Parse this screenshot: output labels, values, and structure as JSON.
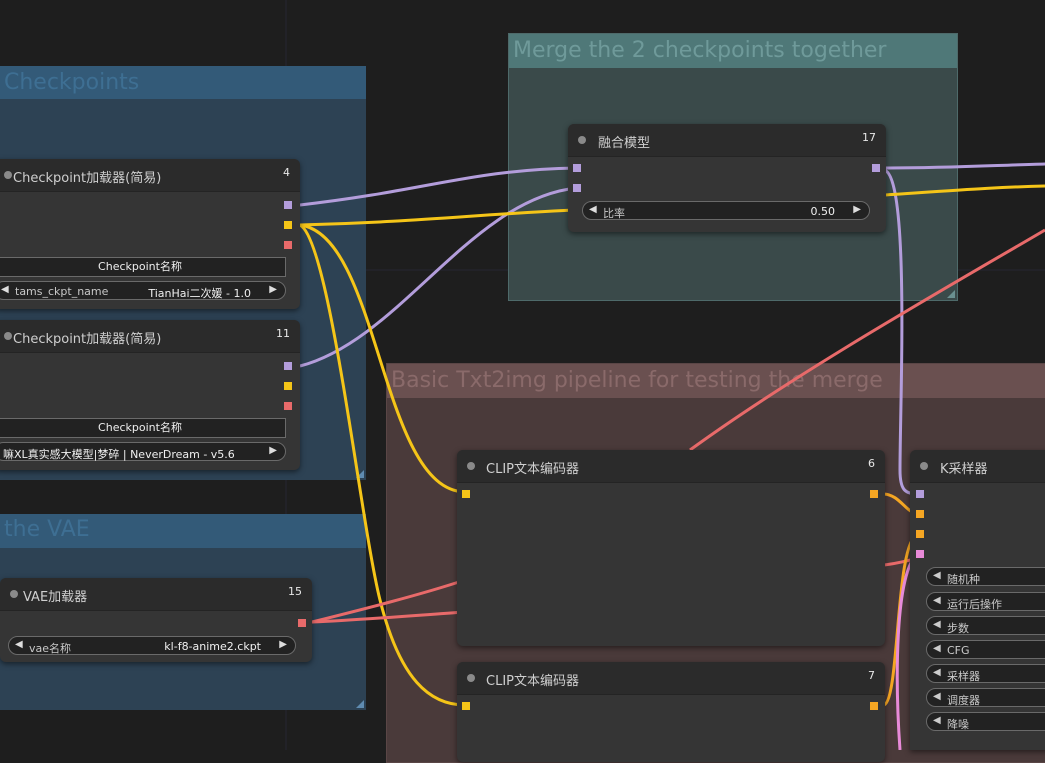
{
  "groups": {
    "checkpoints": "Checkpoints",
    "vae": "the VAE",
    "merge": "Merge the 2 checkpoints together",
    "basic": "Basic Txt2img pipeline for testing the merge"
  },
  "nodes": {
    "ckpt1": {
      "title": "Checkpoint加载器(简易)",
      "id": "4",
      "button": "Checkpoint名称",
      "widget_label": "tams_ckpt_name",
      "widget_value": "TianHai二次媛 - 1.0"
    },
    "ckpt2": {
      "title": "Checkpoint加载器(简易)",
      "id": "11",
      "button": "Checkpoint名称",
      "widget_text": "嘛XL真实感大模型|梦碎 | NeverDream - v5.6"
    },
    "vae": {
      "title": "VAE加载器",
      "id": "15",
      "widget_label": "vae名称",
      "widget_value": "kl-f8-anime2.ckpt"
    },
    "merge": {
      "title": "融合模型",
      "id": "17",
      "widget_label": "比率",
      "widget_value": "0.50"
    },
    "clip1": {
      "title": "CLIP文本编码器",
      "id": "6"
    },
    "clip2": {
      "title": "CLIP文本编码器",
      "id": "7"
    },
    "ksampler": {
      "title": "K采样器",
      "widgets": [
        "随机种",
        "运行后操作",
        "步数",
        "CFG",
        "采样器",
        "调度器",
        "降噪"
      ]
    }
  },
  "colors": {
    "model_wire": "#b39ddb",
    "clip_wire": "#f5c518",
    "vae_wire": "#e86a6a",
    "conditioning_wire": "#f5a623",
    "latent_wire": "#e88ad8"
  }
}
